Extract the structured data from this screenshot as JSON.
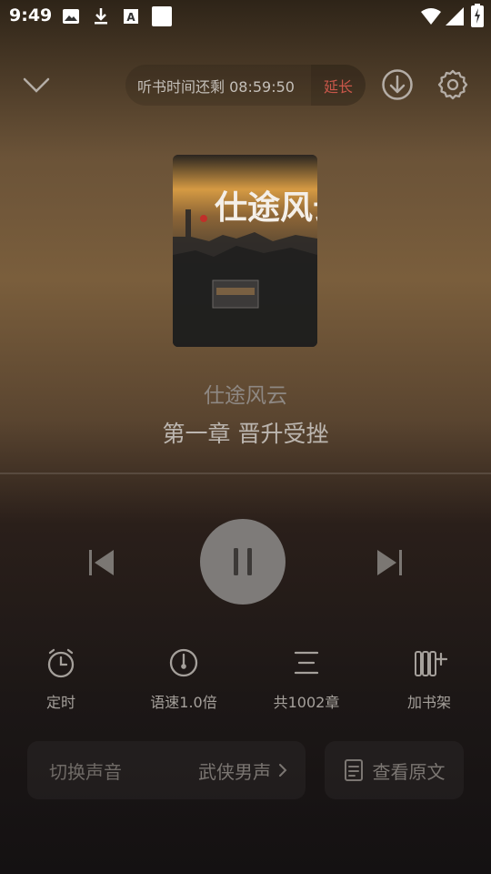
{
  "status_bar": {
    "time": "9:49",
    "left_icons": [
      "image-icon",
      "download-icon",
      "a-text-icon",
      "blank-square-icon"
    ],
    "right_icons": [
      "wifi-icon",
      "signal-icon",
      "battery-icon"
    ]
  },
  "header": {
    "timer_text": "听书时间还剩 08:59:50",
    "extend_label": "延长",
    "accent_color": "#c9574a"
  },
  "book": {
    "cover_title": "仕途风云",
    "title": "仕途风云",
    "chapter": "第一章 晋升受挫"
  },
  "playback": {
    "state": "playing",
    "icons": [
      "previous-icon",
      "pause-icon",
      "next-icon"
    ]
  },
  "features": [
    {
      "label": "定时",
      "icon": "alarm-clock-icon"
    },
    {
      "label": "语速1.0倍",
      "icon": "speed-gauge-icon"
    },
    {
      "label": "共1002章",
      "icon": "chapter-list-icon"
    },
    {
      "label": "加书架",
      "icon": "add-bookshelf-icon"
    }
  ],
  "voice": {
    "label": "切换声音",
    "value": "武侠男声"
  },
  "source_text": {
    "label": "查看原文"
  }
}
